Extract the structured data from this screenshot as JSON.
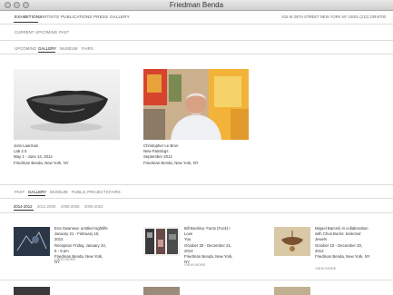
{
  "window": {
    "title": "Friedman Benda"
  },
  "nav": {
    "items": [
      {
        "label": "EXHIBITIONS"
      },
      {
        "label": "ARTISTS"
      },
      {
        "label": "PUBLICATIONS"
      },
      {
        "label": "PRESS"
      },
      {
        "label": "GALLERY"
      }
    ],
    "address": "515 W 26TH STREET NEW YORK NY 10001 (212) 239-8700"
  },
  "subnav": {
    "items": [
      {
        "label": "CURRENT"
      },
      {
        "label": "UPCOMING"
      },
      {
        "label": "PAST"
      }
    ]
  },
  "upcoming_tabs": {
    "items": [
      {
        "label": "UPCOMING"
      },
      {
        "label": "GALLERY"
      },
      {
        "label": "MUSEUM"
      },
      {
        "label": "FAIRS"
      }
    ]
  },
  "featured": [
    {
      "line1": "Joris Laarman",
      "line2": "Lab 2.0",
      "line3": "May 1 - June 14, 2014",
      "line4": "Friedman Benda, New York, NY"
    },
    {
      "line1": "Christopher Le Brun",
      "line2": "New Paintings",
      "line3": "September 2014",
      "line4": "Friedman Benda, New York, NY"
    }
  ],
  "past_tabs": {
    "items": [
      {
        "label": "PAST"
      },
      {
        "label": "GALLERY"
      },
      {
        "label": "MUSEUM"
      },
      {
        "label": "PUBLIC PROJECTS"
      },
      {
        "label": "FAIRS"
      }
    ]
  },
  "years": [
    {
      "label": "2014-2012"
    },
    {
      "label": "2011-2009"
    },
    {
      "label": "2008-2006"
    },
    {
      "label": "2005-2003"
    }
  ],
  "past_items": [
    {
      "lines": [
        "Ena Swansea: untitled nightlife",
        "January 21 - February 15, 2014",
        "Reception Friday, January 24,",
        "6 - 8 pm",
        "Friedman Benda, New York, NY"
      ],
      "view_more": "VIEW MORE"
    },
    {
      "lines": [
        "Bill Beckley: Facts (Fuck) I Love",
        "You",
        "October 30 - December 21,",
        "2013",
        "Friedman Benda, New York, NY"
      ],
      "view_more": "VIEW MORE"
    },
    {
      "lines": [
        "Miquel Barceló in collaboration",
        "with Chus Burés: Selected",
        "Jewels",
        "October 10 - December 20,",
        "2013",
        "Friedman Benda, New York, NY"
      ],
      "view_more": "VIEW MORE"
    }
  ]
}
